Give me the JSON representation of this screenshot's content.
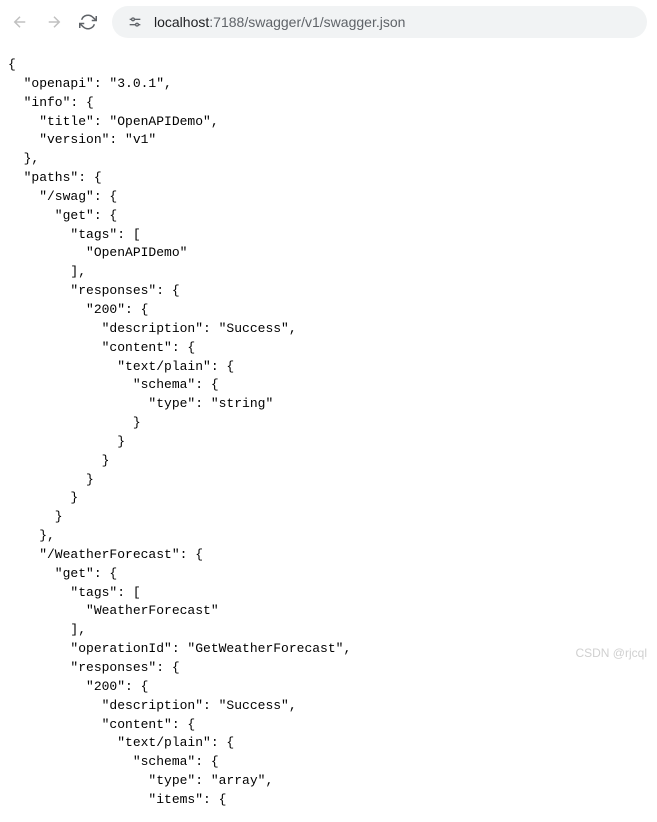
{
  "toolbar": {
    "url_host": "localhost",
    "url_port": ":7188",
    "url_path": "/swagger/v1/swagger.json"
  },
  "json": {
    "l1": "{",
    "l2": "  \"openapi\": \"3.0.1\",",
    "l3": "  \"info\": {",
    "l4": "    \"title\": \"OpenAPIDemo\",",
    "l5": "    \"version\": \"v1\"",
    "l6": "  },",
    "l7": "  \"paths\": {",
    "l8": "    \"/swag\": {",
    "l9": "      \"get\": {",
    "l10": "        \"tags\": [",
    "l11": "          \"OpenAPIDemo\"",
    "l12": "        ],",
    "l13": "        \"responses\": {",
    "l14": "          \"200\": {",
    "l15": "            \"description\": \"Success\",",
    "l16": "            \"content\": {",
    "l17": "              \"text/plain\": {",
    "l18": "                \"schema\": {",
    "l19": "                  \"type\": \"string\"",
    "l20": "                }",
    "l21": "              }",
    "l22": "            }",
    "l23": "          }",
    "l24": "        }",
    "l25": "      }",
    "l26": "    },",
    "l27": "    \"/WeatherForecast\": {",
    "l28": "      \"get\": {",
    "l29": "        \"tags\": [",
    "l30": "          \"WeatherForecast\"",
    "l31": "        ],",
    "l32": "        \"operationId\": \"GetWeatherForecast\",",
    "l33": "        \"responses\": {",
    "l34": "          \"200\": {",
    "l35": "            \"description\": \"Success\",",
    "l36": "            \"content\": {",
    "l37": "              \"text/plain\": {",
    "l38": "                \"schema\": {",
    "l39": "                  \"type\": \"array\",",
    "l40": "                  \"items\": {"
  },
  "watermark": "CSDN @rjcql"
}
